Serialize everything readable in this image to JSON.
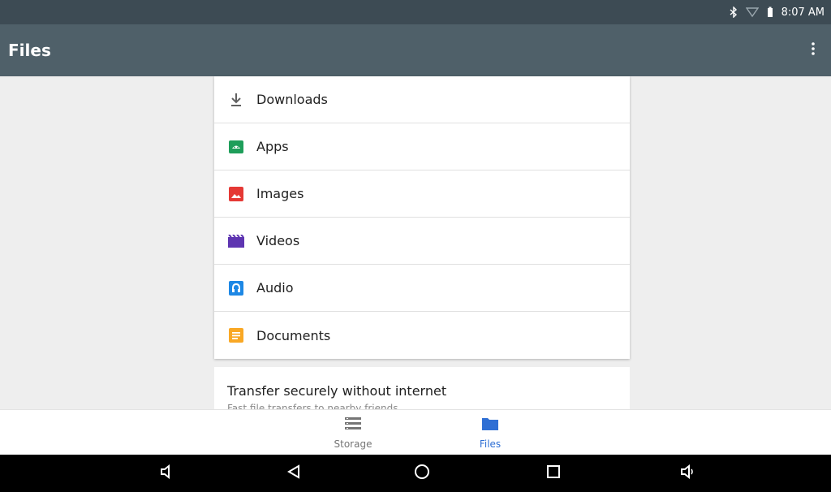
{
  "status_bar": {
    "time": "8:07 AM",
    "icons": [
      "bluetooth-icon",
      "wifi-icon",
      "battery-icon"
    ]
  },
  "app_bar": {
    "title": "Files",
    "menu_icon": "more-vert-icon"
  },
  "categories": [
    {
      "label": "Downloads",
      "icon": "download-icon",
      "color": "#616161"
    },
    {
      "label": "Apps",
      "icon": "android-icon",
      "color": "#1e9e5a"
    },
    {
      "label": "Images",
      "icon": "image-icon",
      "color": "#e53935"
    },
    {
      "label": "Videos",
      "icon": "video-icon",
      "color": "#5e35b1"
    },
    {
      "label": "Audio",
      "icon": "headphones-icon",
      "color": "#1e88e5"
    },
    {
      "label": "Documents",
      "icon": "document-icon",
      "color": "#f9a825"
    }
  ],
  "promo": {
    "title": "Transfer securely without internet",
    "subtitle": "Fast file transfers to nearby friends"
  },
  "bottom_nav": {
    "items": [
      {
        "label": "Storage",
        "icon": "storage-icon",
        "active": false
      },
      {
        "label": "Files",
        "icon": "folder-icon",
        "active": true
      }
    ],
    "active_color": "#2f6fd4",
    "inactive_color": "#757575"
  },
  "system_nav": [
    "volume-down-icon",
    "back-icon",
    "home-icon",
    "recents-icon",
    "volume-up-icon"
  ]
}
